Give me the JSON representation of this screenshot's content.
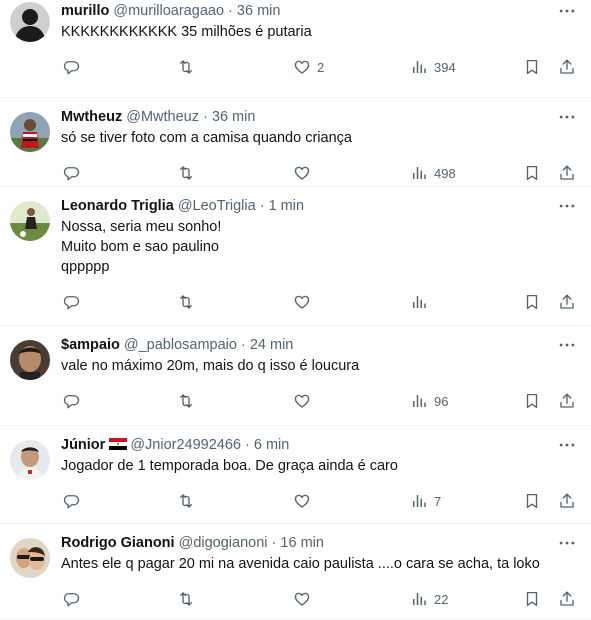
{
  "tweets": [
    {
      "name": "murillo",
      "handle": "@murilloaragaao",
      "time": "36 min",
      "lines": [
        "KKKKKKKKKKKK 35 milhões é putaria"
      ],
      "likes": "2",
      "views": "394",
      "avatar": "dark-silhouette"
    },
    {
      "name": "Mwtheuz",
      "handle": "@Mwtheuz",
      "time": "36 min",
      "lines": [
        "só se tiver foto com a camisa quando criança"
      ],
      "likes": "",
      "views": "498",
      "avatar": "player-red"
    },
    {
      "name": "Leonardo Triglia",
      "handle": "@LeoTriglia",
      "time": "1 min",
      "lines": [
        "Nossa, seria meu sonho!",
        "Muito bom e sao paulino",
        "qppppp"
      ],
      "likes": "",
      "views": "",
      "avatar": "soccer-field"
    },
    {
      "name": "$ampaio",
      "handle": "@_pablosampaio",
      "time": "24 min",
      "lines": [
        "vale no máximo 20m, mais do q isso é loucura"
      ],
      "likes": "",
      "views": "96",
      "avatar": "face-dark"
    },
    {
      "name": "Júnior",
      "handle": "@Jnior24992466",
      "time": "6 min",
      "lines": [
        "Jogador de 1 temporada boa. De graça ainda é caro"
      ],
      "likes": "",
      "views": "7",
      "avatar": "face-light",
      "flag": "egypt-flag"
    },
    {
      "name": "Rodrigo Gianoni",
      "handle": "@digogianoni",
      "time": "16 min",
      "lines": [
        "Antes ele q pagar 20 mi na avenida caio paulista ....o cara se acha, ta loko"
      ],
      "likes": "",
      "views": "22",
      "avatar": "couple"
    }
  ],
  "icons": {
    "reply": "reply-icon",
    "retweet": "retweet-icon",
    "like": "heart-icon",
    "views": "views-icon",
    "bookmark": "bookmark-icon",
    "share": "share-icon",
    "more": "more-icon"
  },
  "colors": {
    "text": "#0f1419",
    "secondary": "#536471",
    "divider": "#eff3f4"
  }
}
